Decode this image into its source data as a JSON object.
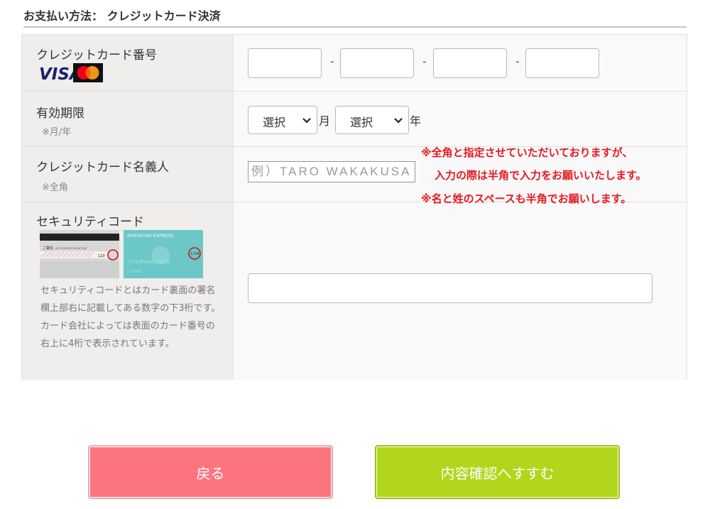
{
  "section": {
    "title": "お支払い方法： クレジットカード決済"
  },
  "card_number": {
    "label": "クレジットカード番号",
    "brands": {
      "visa_text": "VISA"
    },
    "separator": "-"
  },
  "expiry": {
    "label": "有効期限",
    "note": "※月/年",
    "month_select": {
      "value": "選択",
      "unit": "月"
    },
    "year_select": {
      "value": "選択",
      "unit": "年"
    }
  },
  "holder": {
    "label": "クレジットカード名義人",
    "note": "※全角",
    "placeholder": "例）TARO WAKAKUSA",
    "notice_lines": [
      "※全角と指定させていただいておりますが、",
      "入力の際は半角で入力をお願いいたします。",
      "※名と姓のスペースも半角でお願いします。"
    ]
  },
  "security": {
    "label": "セキュリティコード",
    "card_images": {
      "back_signature_label": "ご署名",
      "back_authorized": "AUTHORIZED SIGNATURE",
      "back_code": "123",
      "amex_title": "AMERICAN EXPRESS",
      "amex_code": "1234",
      "amex_number": "3759 876543 21001",
      "amex_name": "C F FROST"
    },
    "description": [
      "セキュリティコードとはカード裏面の署名欄上部右に記載してある数字の下3桁です。",
      "カード会社によっては表面のカード番号の右上に4桁で表示されています。"
    ]
  },
  "buttons": {
    "back_label": "戻る",
    "next_label": "内容確認へすすむ"
  },
  "colors": {
    "back_button": "#fc757e",
    "next_button": "#b2d61c",
    "notice": "#e8171f"
  }
}
